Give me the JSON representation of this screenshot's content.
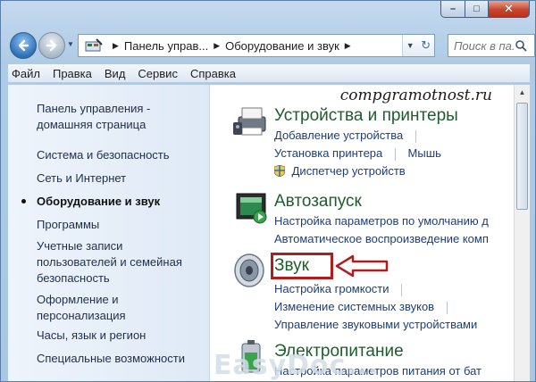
{
  "window": {
    "caption_buttons": {
      "minimize": "–",
      "maximize": "□",
      "close": "✕"
    }
  },
  "navigation": {
    "back_icon": "back-arrow-icon",
    "forward_icon": "forward-arrow-icon",
    "breadcrumb": [
      "Панель управ...",
      "Оборудование и звук"
    ],
    "search_placeholder": "Поиск в па..."
  },
  "menu": [
    "Файл",
    "Правка",
    "Вид",
    "Сервис",
    "Справка"
  ],
  "sidebar": {
    "items": [
      {
        "label": "Панель управления - домашняя страница"
      },
      {
        "label": "Система и безопасность"
      },
      {
        "label": "Сеть и Интернет"
      },
      {
        "label": "Оборудование и звук",
        "active": true
      },
      {
        "label": "Программы"
      },
      {
        "label": "Учетные записи пользователей и семейная безопасность"
      },
      {
        "label": "Оформление и персонализация"
      },
      {
        "label": "Часы, язык и регион"
      },
      {
        "label": "Специальные возможности"
      }
    ]
  },
  "watermark_text": "compgramotnost.ru",
  "categories": [
    {
      "title": "Устройства и принтеры",
      "icon": "printer-icon",
      "links": [
        "Добавление устройства",
        "Установка принтера",
        "Мышь",
        "Диспетчер устройств"
      ]
    },
    {
      "title": "Автозапуск",
      "icon": "autoplay-icon",
      "links": [
        "Настройка параметров по умолчанию д",
        "Автоматическое воспроизведение комп"
      ]
    },
    {
      "title": "Звук",
      "icon": "speaker-icon",
      "links": [
        "Настройка громкости",
        "Изменение системных звуков",
        "Управление звуковыми устройствами"
      ]
    },
    {
      "title": "Электропитание",
      "icon": "power-icon",
      "links": [
        "Настройка параметров питания от бат"
      ]
    }
  ],
  "bottom_watermark": "EasyDoc...",
  "colors": {
    "category_title": "#1e5e2c",
    "link": "#1b3f7a",
    "highlight": "#b11c1c"
  }
}
